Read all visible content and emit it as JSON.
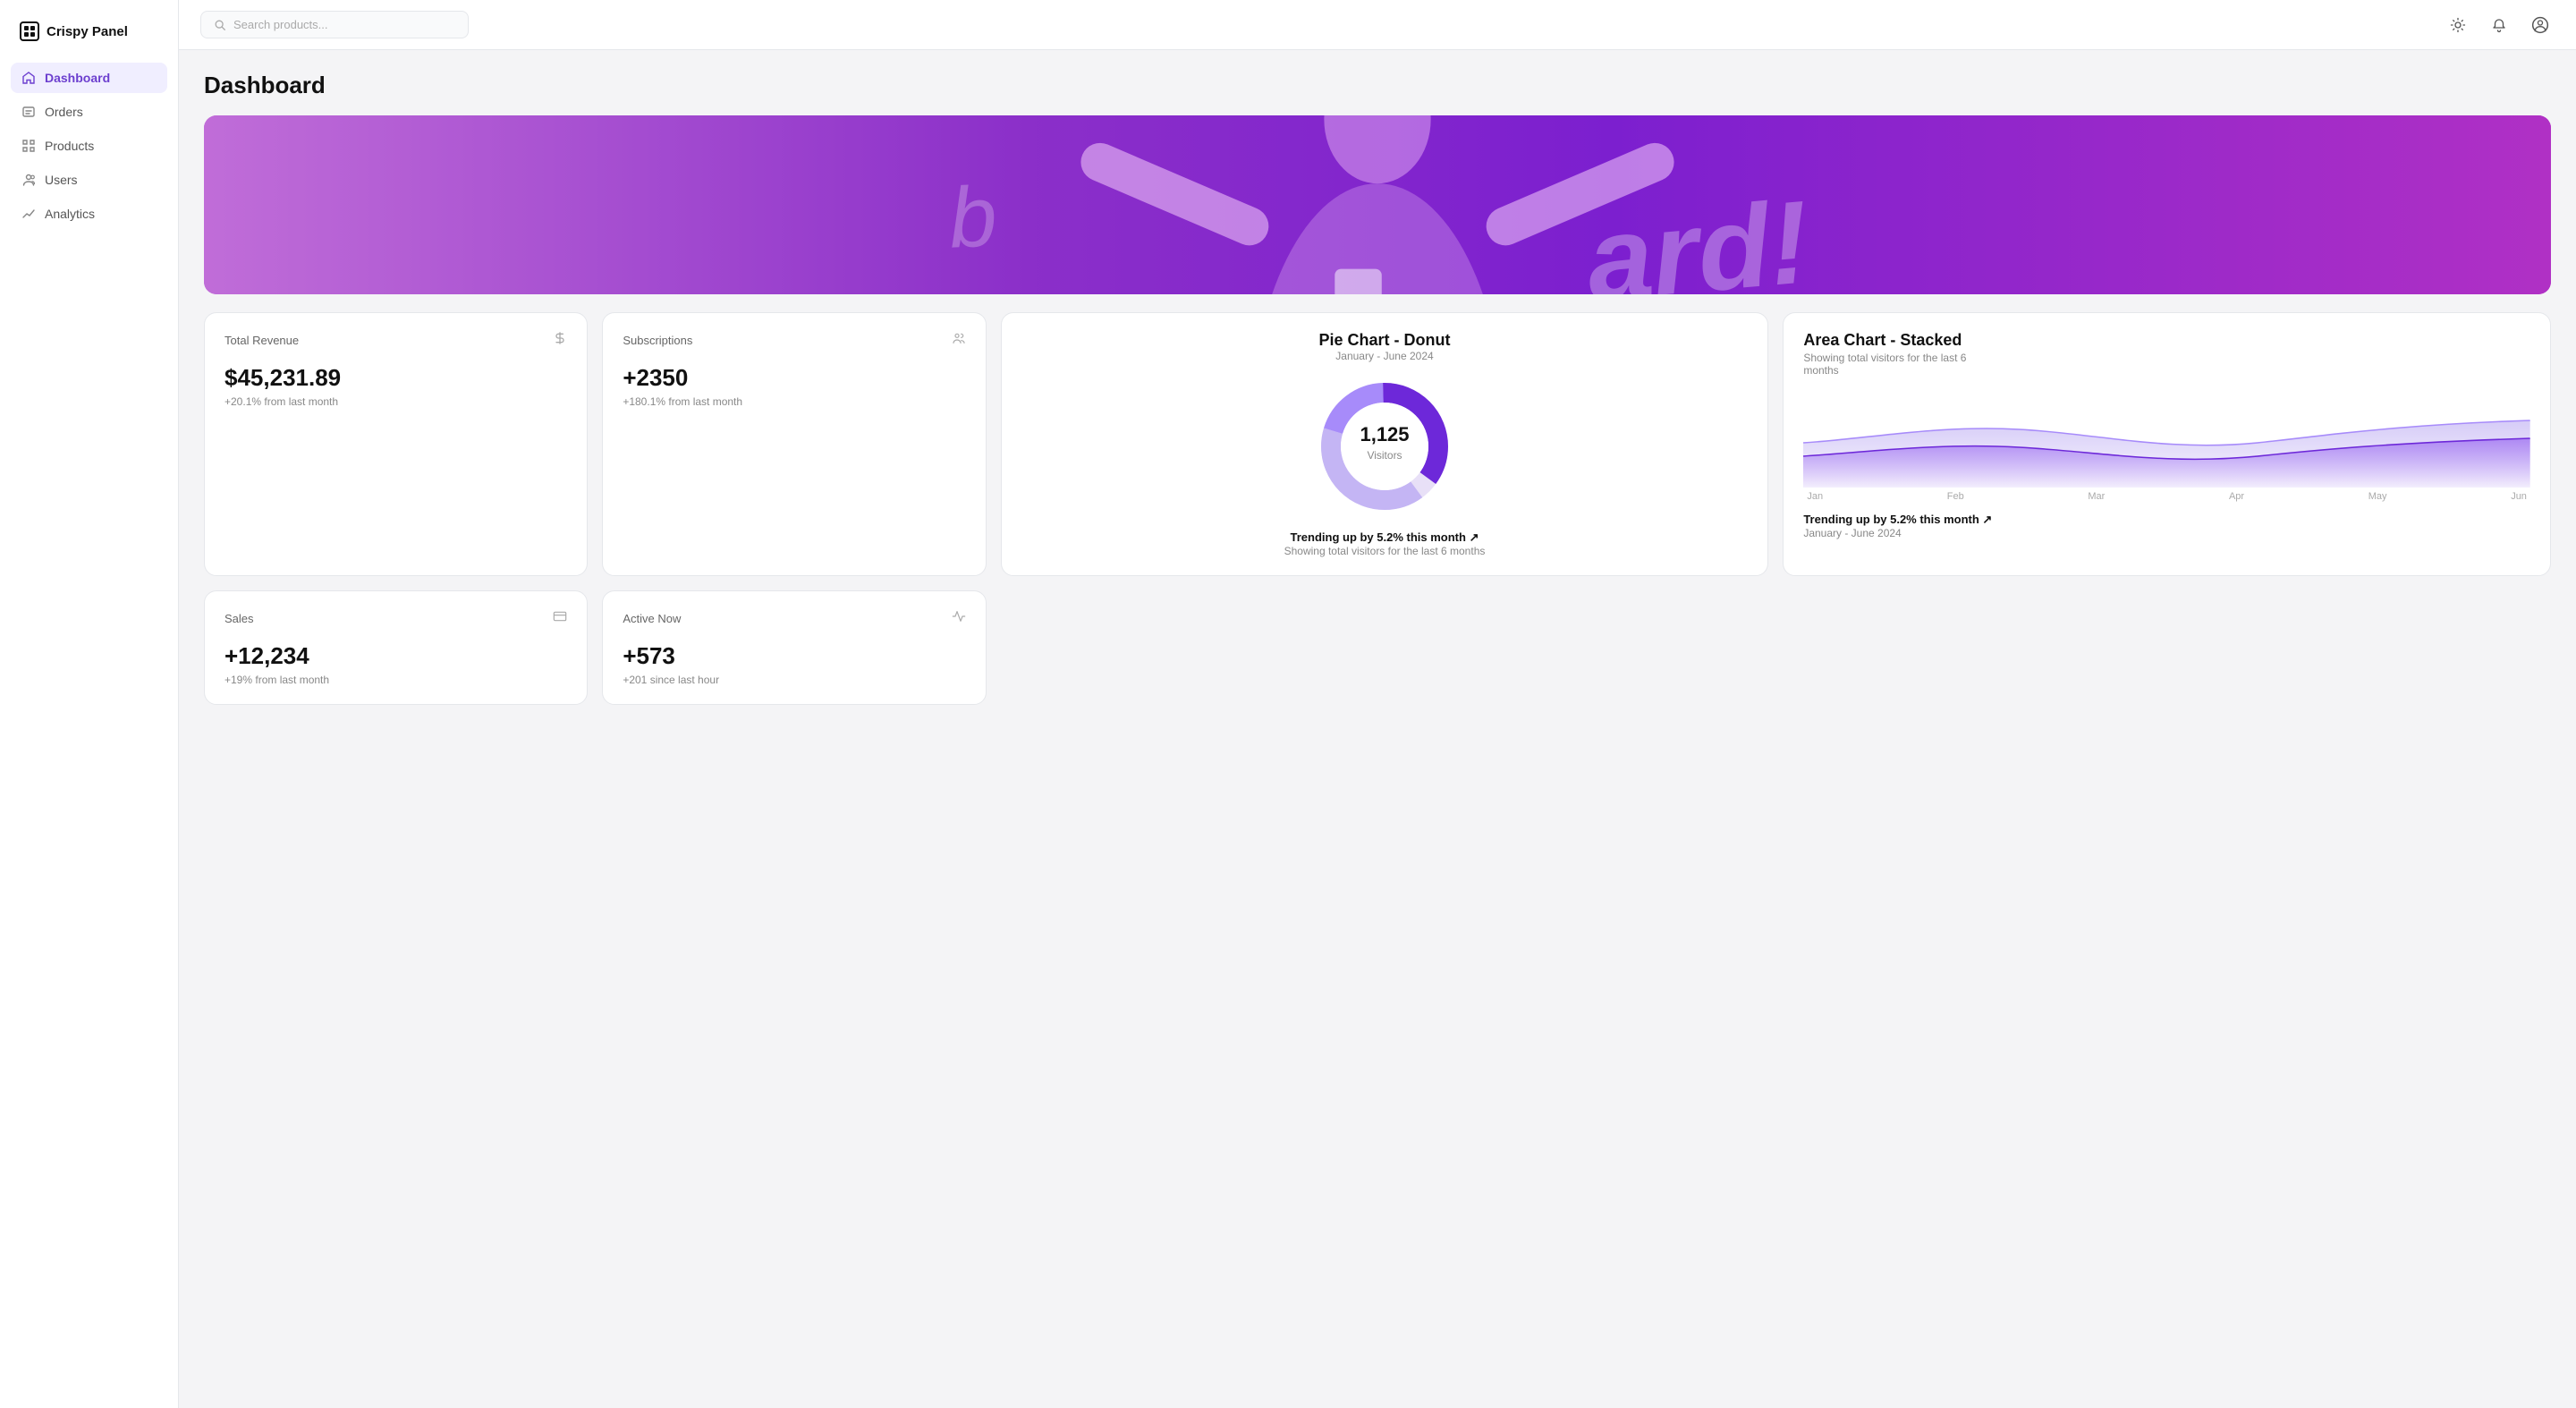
{
  "app": {
    "name": "Crispy Panel"
  },
  "header": {
    "search_placeholder": "Search products..."
  },
  "sidebar": {
    "items": [
      {
        "id": "dashboard",
        "label": "Dashboard",
        "active": true
      },
      {
        "id": "orders",
        "label": "Orders",
        "active": false
      },
      {
        "id": "products",
        "label": "Products",
        "active": false
      },
      {
        "id": "users",
        "label": "Users",
        "active": false
      },
      {
        "id": "analytics",
        "label": "Analytics",
        "active": false
      }
    ]
  },
  "page": {
    "title": "Dashboard"
  },
  "stats": {
    "total_revenue": {
      "label": "Total Revenue",
      "value": "$45,231.89",
      "change": "+20.1% from last month"
    },
    "subscriptions": {
      "label": "Subscriptions",
      "value": "+2350",
      "change": "+180.1% from last month"
    },
    "sales": {
      "label": "Sales",
      "value": "+12,234",
      "change": "+19% from last month"
    },
    "active_now": {
      "label": "Active Now",
      "value": "+573",
      "change": "+201 since last hour"
    }
  },
  "donut_chart": {
    "title": "Pie Chart - Donut",
    "subtitle": "January - June 2024",
    "center_value": "1,125",
    "center_label": "Visitors",
    "trend": "Trending up by 5.2% this month ↗",
    "description": "Showing total visitors for the last 6 months"
  },
  "area_chart": {
    "title": "Area Chart - Stacked",
    "subtitle": "Showing total visitors for the last 6 months",
    "x_labels": [
      "Jan",
      "Feb",
      "Mar",
      "Apr",
      "May",
      "Jun"
    ],
    "trend": "Trending up by 5.2% this month ↗",
    "date_range": "January - June 2024"
  }
}
